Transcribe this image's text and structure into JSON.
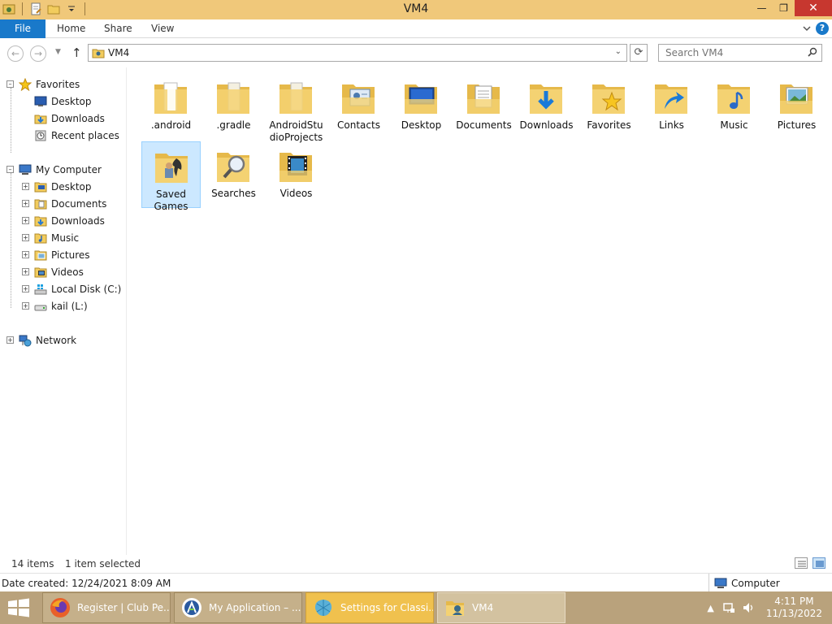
{
  "window": {
    "title": "VM4",
    "minimize_glyph": "—",
    "maximize_glyph": "❐",
    "close_glyph": "✕"
  },
  "ribbon": {
    "file_label": "File",
    "tabs": [
      "Home",
      "Share",
      "View"
    ]
  },
  "address": {
    "path": "VM4",
    "search_placeholder": "Search VM4"
  },
  "navigation": {
    "favorites_label": "Favorites",
    "favorites": [
      "Desktop",
      "Downloads",
      "Recent places"
    ],
    "computer_label": "My Computer",
    "computer_items": [
      "Desktop",
      "Documents",
      "Downloads",
      "Music",
      "Pictures",
      "Videos",
      "Local Disk (C:)",
      "kail (L:)"
    ],
    "network_label": "Network"
  },
  "folders": [
    {
      "name": ".android",
      "icon": "folder-icon"
    },
    {
      "name": ".gradle",
      "icon": "folder-icon"
    },
    {
      "name": "AndroidStudioProjects",
      "icon": "folder-icon"
    },
    {
      "name": "Contacts",
      "icon": "contacts-folder-icon"
    },
    {
      "name": "Desktop",
      "icon": "desktop-folder-icon"
    },
    {
      "name": "Documents",
      "icon": "documents-folder-icon"
    },
    {
      "name": "Downloads",
      "icon": "downloads-folder-icon"
    },
    {
      "name": "Favorites",
      "icon": "favorites-folder-icon"
    },
    {
      "name": "Links",
      "icon": "links-folder-icon"
    },
    {
      "name": "Music",
      "icon": "music-folder-icon"
    },
    {
      "name": "Pictures",
      "icon": "pictures-folder-icon"
    },
    {
      "name": "Saved Games",
      "icon": "saved-games-folder-icon",
      "selected": true
    },
    {
      "name": "Searches",
      "icon": "searches-folder-icon"
    },
    {
      "name": "Videos",
      "icon": "videos-folder-icon"
    }
  ],
  "status": {
    "item_count": "14 items",
    "selection": "1 item selected"
  },
  "details": {
    "date_created": "Date created: 12/24/2021 8:09 AM",
    "zone": "Computer"
  },
  "taskbar": {
    "buttons": [
      {
        "label": "Register | Club Pe...",
        "icon": "firefox-icon"
      },
      {
        "label": "My Application – ...",
        "icon": "android-studio-icon"
      },
      {
        "label": "Settings for Classi...",
        "icon": "classic-shell-icon"
      },
      {
        "label": "VM4",
        "icon": "explorer-folder-icon"
      }
    ],
    "time": "4:11 PM",
    "date": "11/13/2022"
  },
  "colors": {
    "titlebar": "#f0c87a",
    "file_tab": "#1979ca",
    "selection": "#cce8ff",
    "taskbar": "#b9a27c",
    "close_button": "#c7372f"
  }
}
